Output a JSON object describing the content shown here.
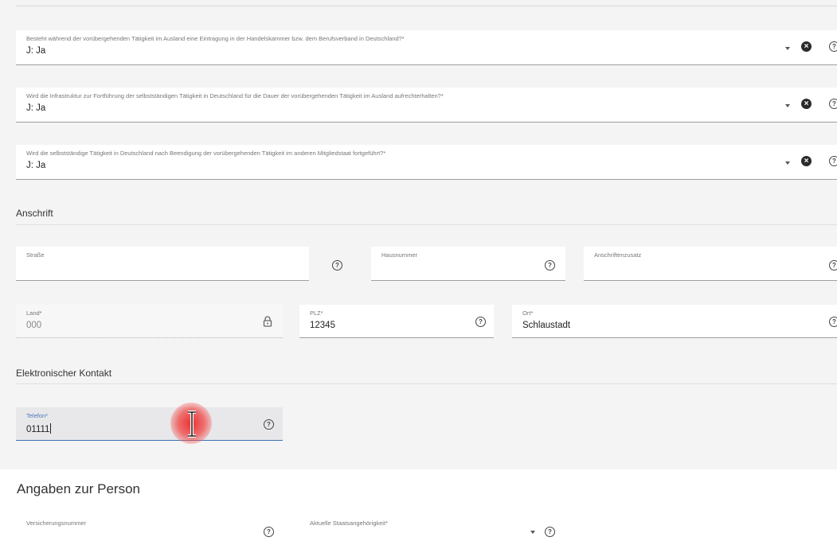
{
  "questions": [
    {
      "label": "Besteht während der vorübergehenden Tätigkeit im Ausland eine Eintragung in der Handelskammer bzw. dem Berufsverband in Deutschland?*",
      "value": "J: Ja"
    },
    {
      "label": "Wird die Infrastruktur zur Fortführung der selbstständigen Tätigkeit in Deutschland für die Dauer der vorübergehenden Tätigkeit im Ausland aufrechterhalten?*",
      "value": "J: Ja"
    },
    {
      "label": "Wird die selbstständige Tätigkeit in Deutschland nach Beendigung der vorübergehenden Tätigkeit im anderen Mitgliedstaat fortgeführt?*",
      "value": "J: Ja"
    }
  ],
  "anschrift": {
    "title": "Anschrift",
    "strasse": {
      "label": "Straße",
      "value": ""
    },
    "hausnummer": {
      "label": "Hausnummer",
      "value": ""
    },
    "zusatz": {
      "label": "Anschriftenzusatz",
      "value": ""
    },
    "land": {
      "label": "Land*",
      "value": "000"
    },
    "plz": {
      "label": "PLZ*",
      "value": "12345"
    },
    "ort": {
      "label": "Ort*",
      "value": "Schlaustadt"
    }
  },
  "kontakt": {
    "title": "Elektronischer Kontakt",
    "telefon": {
      "label": "Telefon*",
      "value": "01111"
    }
  },
  "person": {
    "title": "Angaben zur Person",
    "versicherungsnummer": {
      "label": "Versicherungsnummer",
      "value": ""
    },
    "staatsangehoerigkeit": {
      "label": "Aktuelle Staatsangehörigkeit*",
      "value": ""
    }
  },
  "icons": {
    "help": "help-circle-icon",
    "clear": "clear-circle-icon",
    "dropdown": "dropdown-arrow-icon",
    "lock": "lock-icon"
  },
  "colors": {
    "focus_accent": "#3a6fb0",
    "cursor_highlight": "#e82828",
    "panel_background": "#f4f4f4"
  }
}
